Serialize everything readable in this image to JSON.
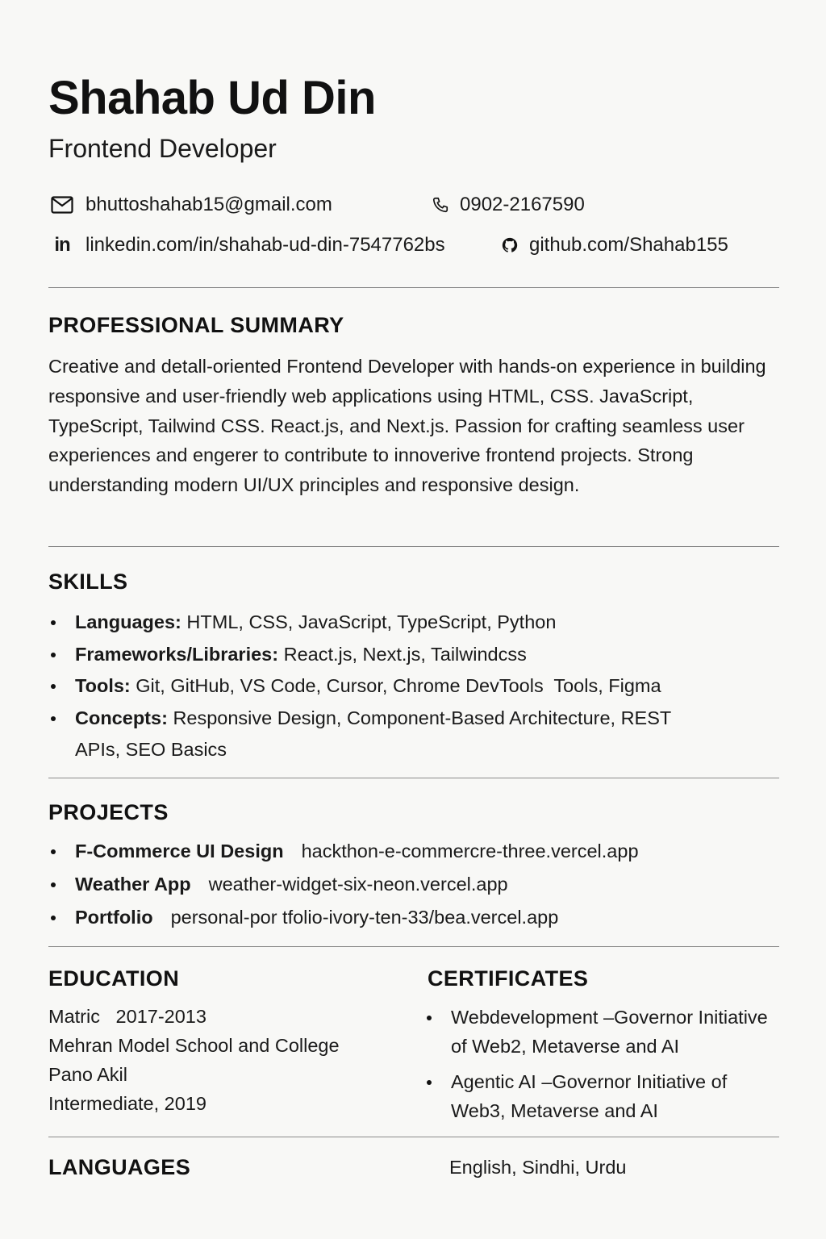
{
  "header": {
    "name": "Shahab Ud Din",
    "title": "Frontend Developer"
  },
  "contact": {
    "email": "bhuttoshahab15@gmail.com",
    "phone": "0902-2167590",
    "linkedin_glyph": "in",
    "linkedin": "linkedin.com/in/shahab-ud-din-7547762bs",
    "github": "github.com/Shahab155"
  },
  "summary": {
    "heading": "PROFESSIONAL SUMMARY",
    "text": "Creative and detall-oriented Frontend Developer with hands-on experience in building responsive and user-friendly web applications using HTML, CSS. JavaScript, TypeScript, Tailwind CSS. React.js, and Next.js. Passion for crafting seamless user experiences and engerer to contribute to innoverive frontend projects. Strong understanding modern UI/UX principles and responsive design."
  },
  "skills": {
    "heading": "SKILLS",
    "items": [
      {
        "label": "Languages:",
        "value": "HTML, CSS, JavaScript, TypeScript, Python"
      },
      {
        "label": "Frameworks/Libraries:",
        "value": "React.js, Next.js, Tailwindcss"
      },
      {
        "label": "Tools:",
        "value": "Git, GitHub, VS Code, Cursor, Chrome DevTools  Tools, Figma"
      },
      {
        "label": "Concepts:",
        "value": "Responsive Design, Component-Based Architecture, REST",
        "value2": "APIs, SEO Basics"
      }
    ]
  },
  "projects": {
    "heading": "PROJECTS",
    "items": [
      {
        "name": "F-Commerce UI Design",
        "url": "hackthon-e-commercre-three.vercel.app"
      },
      {
        "name": "Weather App",
        "url": "weather-widget-six-neon.vercel.app"
      },
      {
        "name": "Portfolio",
        "url": "personal-por tfolio-ivory-ten-33/bea.vercel.app"
      }
    ]
  },
  "education": {
    "heading": "EDUCATION",
    "lines": [
      "Matric   2017-2013",
      "Mehran Model School and College",
      "Pano Akil",
      "Intermediate, 2019"
    ]
  },
  "certificates": {
    "heading": "CERTIFICATES",
    "items": [
      {
        "line1": "Webdevelopment –Governor Initiative",
        "line2": "of Web2, Metaverse and AI"
      },
      {
        "line1": "Agentic AI –Governor Initiative of",
        "line2": "Web3, Metaverse and AI"
      }
    ]
  },
  "languages": {
    "heading": "LANGUAGES",
    "value": "English, Sindhi, Urdu"
  }
}
